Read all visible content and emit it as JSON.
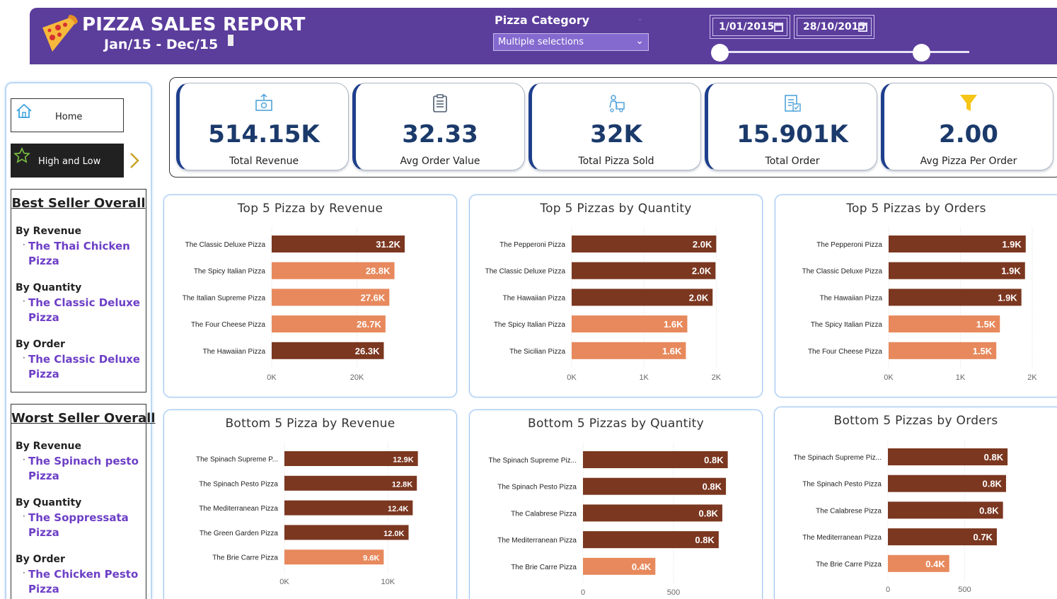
{
  "header": {
    "title": "PIZZA SALES REPORT",
    "subtitle": "Jan/15  -  Dec/15",
    "category_label": "Pizza Category",
    "category_value": "Multiple selections",
    "date_start": "1/01/2015",
    "date_end": "28/10/2015",
    "slider_start_fraction": 0,
    "slider_end_fraction": 0.81
  },
  "nav": {
    "home_label": "Home",
    "high_low_label": "High and Low"
  },
  "best_seller": {
    "title": "Best Seller Overall",
    "by_revenue_label": "By Revenue",
    "by_revenue_value": "The Thai Chicken Pizza",
    "by_quantity_label": "By Quantity",
    "by_quantity_value": "The Classic Deluxe Pizza",
    "by_order_label": "By Order",
    "by_order_value": "The Classic Deluxe Pizza"
  },
  "worst_seller": {
    "title": "Worst Seller Overall",
    "by_revenue_label": "By Revenue",
    "by_revenue_value": "The Spinach pesto Pizza",
    "by_quantity_label": "By Quantity",
    "by_quantity_value": "The Soppressata Pizza",
    "by_order_label": "By Order",
    "by_order_value": "The Chicken Pesto Pizza"
  },
  "kpis": [
    {
      "value": "514.15K",
      "label": "Total Revenue",
      "icon": "money-icon"
    },
    {
      "value": "32.33",
      "label": "Avg Order Value",
      "icon": "clipboard-icon"
    },
    {
      "value": "32K",
      "label": "Total Pizza Sold",
      "icon": "delivery-icon"
    },
    {
      "value": "15.901K",
      "label": "Total Order",
      "icon": "document-icon"
    },
    {
      "value": "2.00",
      "label": "Avg Pizza Per Order",
      "icon": "funnel-icon"
    }
  ],
  "colors": {
    "header_bg": "#5b3d9c",
    "bar_dark": "#7b3720",
    "bar_light": "#e7895c",
    "kpi_value": "#1b3a6b",
    "seller_value": "#6d3fc6"
  },
  "chart_data": [
    {
      "type": "bar",
      "orientation": "horizontal",
      "title": "Top 5 Pizza by Revenue",
      "categories": [
        "The Classic Deluxe Pizza",
        "The Spicy Italian Pizza",
        "The Italian Supreme Pizza",
        "The Four Cheese Pizza",
        "The Hawaiian Pizza"
      ],
      "values": [
        31200,
        28800,
        27600,
        26700,
        26300
      ],
      "labels": [
        "31.2K",
        "28.8K",
        "27.6K",
        "26.7K",
        "26.3K"
      ],
      "shades": [
        "dark",
        "light",
        "light",
        "light",
        "dark"
      ],
      "xlim": [
        0,
        39000
      ],
      "ticks": [
        0,
        20000
      ],
      "tick_labels": [
        "0K",
        "20K"
      ]
    },
    {
      "type": "bar",
      "orientation": "horizontal",
      "title": "Top 5 Pizzas by Quantity",
      "categories": [
        "The Pepperoni Pizza",
        "The Classic Deluxe Pizza",
        "The Hawaiian Pizza",
        "The Spicy Italian Pizza",
        "The Sicilian Pizza"
      ],
      "values": [
        2000,
        1990,
        1950,
        1600,
        1580
      ],
      "labels": [
        "2.0K",
        "2.0K",
        "2.0K",
        "1.6K",
        "1.6K"
      ],
      "shades": [
        "dark",
        "dark",
        "dark",
        "light",
        "light"
      ],
      "xlim": [
        0,
        2300
      ],
      "ticks": [
        0,
        1000,
        2000
      ],
      "tick_labels": [
        "0K",
        "1K",
        "2K"
      ]
    },
    {
      "type": "bar",
      "orientation": "horizontal",
      "title": "Top 5 Pizzas by Orders",
      "categories": [
        "The Pepperoni Pizza",
        "The Classic Deluxe Pizza",
        "The Hawaiian Pizza",
        "The Spicy Italian Pizza",
        "The Four Cheese Pizza"
      ],
      "values": [
        1910,
        1900,
        1850,
        1550,
        1500
      ],
      "labels": [
        "1.9K",
        "1.9K",
        "1.9K",
        "1.5K",
        "1.5K"
      ],
      "shades": [
        "dark",
        "dark",
        "dark",
        "light",
        "light"
      ],
      "xlim": [
        0,
        2050
      ],
      "ticks": [
        0,
        1000,
        2000
      ],
      "tick_labels": [
        "0K",
        "1K",
        "2K"
      ]
    },
    {
      "type": "bar",
      "orientation": "horizontal",
      "title": "Bottom 5 Pizza by Revenue",
      "categories": [
        "The Spinach Supreme P...",
        "The Spinach Pesto Pizza",
        "The Mediterranean Pizza",
        "The Green Garden Pizza",
        "The Brie Carre Pizza"
      ],
      "values": [
        12900,
        12800,
        12400,
        12000,
        9600
      ],
      "labels": [
        "12.9K",
        "12.8K",
        "12.4K",
        "12.0K",
        "9.6K"
      ],
      "shades": [
        "dark",
        "dark",
        "dark",
        "dark",
        "light"
      ],
      "xlim": [
        0,
        16000
      ],
      "ticks": [
        0,
        10000
      ],
      "tick_labels": [
        "0K",
        "10K"
      ]
    },
    {
      "type": "bar",
      "orientation": "horizontal",
      "title": "Bottom 5 Pizzas by Quantity",
      "categories": [
        "The Spinach Supreme Piz...",
        "The Spinach Pesto Pizza",
        "The Calabrese Pizza",
        "The Mediterranean Pizza",
        "The Brie Carre Pizza"
      ],
      "values": [
        800,
        790,
        770,
        750,
        400
      ],
      "labels": [
        "0.8K",
        "0.8K",
        "0.8K",
        "0.8K",
        "0.4K"
      ],
      "shades": [
        "dark",
        "dark",
        "dark",
        "dark",
        "light"
      ],
      "xlim": [
        0,
        950
      ],
      "ticks": [
        0,
        500
      ],
      "tick_labels": [
        "0",
        "500"
      ]
    },
    {
      "type": "bar",
      "orientation": "horizontal",
      "title": "Bottom 5 Pizzas by Orders",
      "categories": [
        "The Spinach Supreme Piz...",
        "The Spinach Pesto Pizza",
        "The Calabrese Pizza",
        "The Mediterranean Pizza",
        "The Brie Carre Pizza"
      ],
      "values": [
        780,
        770,
        750,
        710,
        400
      ],
      "labels": [
        "0.8K",
        "0.8K",
        "0.8K",
        "0.7K",
        "0.4K"
      ],
      "shades": [
        "dark",
        "dark",
        "dark",
        "dark",
        "light"
      ],
      "xlim": [
        0,
        950
      ],
      "ticks": [
        0,
        500
      ],
      "tick_labels": [
        "0",
        "500"
      ]
    }
  ]
}
